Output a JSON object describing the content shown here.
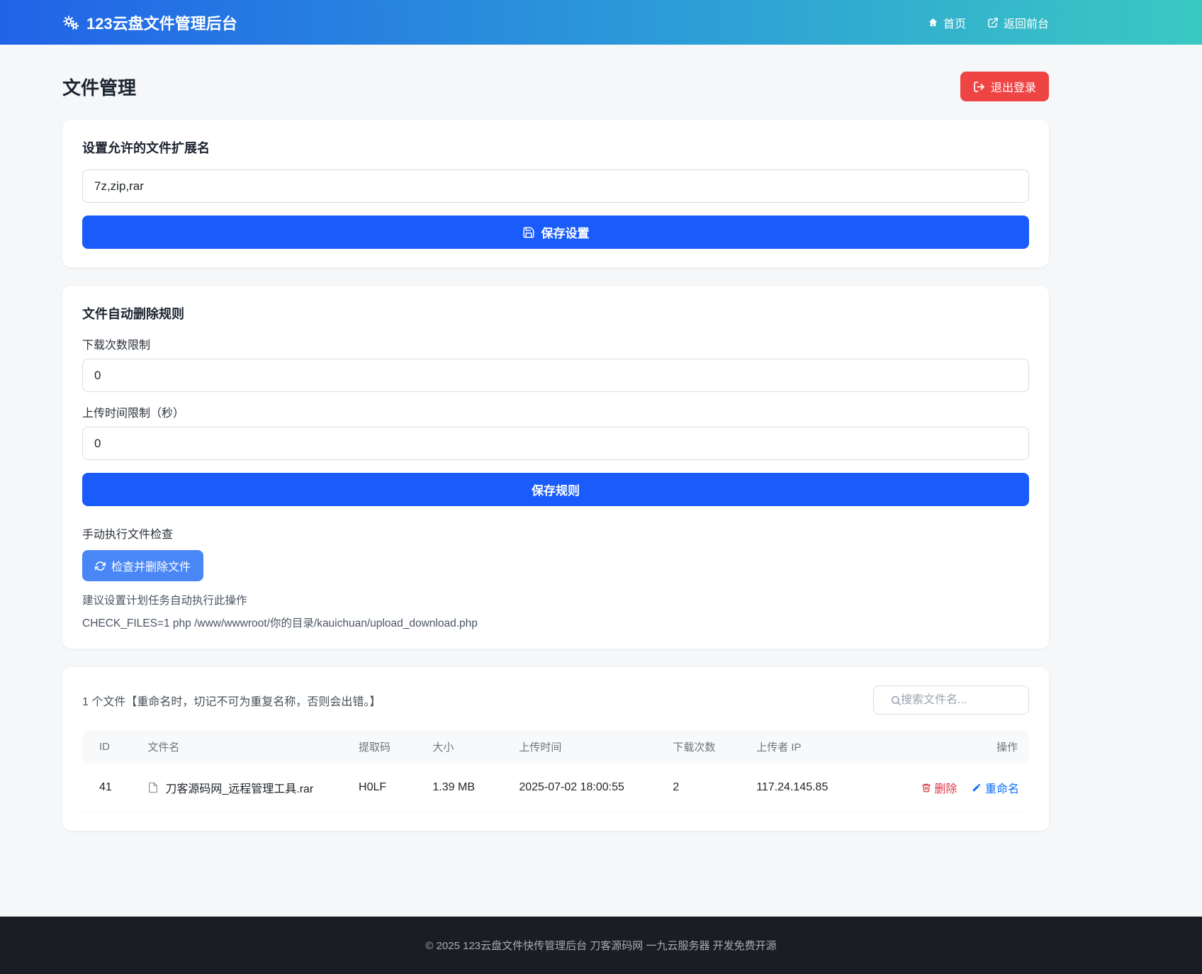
{
  "navbar": {
    "title": "123云盘文件管理后台",
    "links": [
      {
        "label": "首页"
      },
      {
        "label": "返回前台"
      }
    ]
  },
  "header": {
    "title": "文件管理",
    "logout_label": "退出登录"
  },
  "extension_card": {
    "heading": "设置允许的文件扩展名",
    "input_value": "7z,zip,rar",
    "save_label": "保存设置"
  },
  "rules_card": {
    "heading": "文件自动删除规则",
    "download_limit_label": "下载次数限制",
    "download_limit_value": "0",
    "upload_time_label": "上传时间限制（秒）",
    "upload_time_value": "0",
    "save_label": "保存规则",
    "manual_check_label": "手动执行文件检查",
    "check_button_label": "检查并删除文件",
    "tip1": "建议设置计划任务自动执行此操作",
    "tip2": "CHECK_FILES=1 php /www/wwwroot/你的目录/kauichuan/upload_download.php"
  },
  "files_card": {
    "summary": "1 个文件【重命名时，切记不可为重复名称，否则会出错。】",
    "search_placeholder": "搜索文件名...",
    "table": {
      "headers": [
        "ID",
        "文件名",
        "提取码",
        "大小",
        "上传时间",
        "下载次数",
        "上传者 IP",
        "操作"
      ],
      "rows": [
        {
          "id": "41",
          "name": "刀客源码网_远程管理工具.rar",
          "code": "H0LF",
          "size": "1.39 MB",
          "uploaded": "2025-07-02 18:00:55",
          "downloads": "2",
          "ip": "117.24.145.85",
          "delete_label": "删除",
          "rename_label": "重命名"
        }
      ]
    }
  },
  "footer": {
    "copyright": "© 2025 123云盘文件快传管理后台 刀客源码网 一九云服务器 开发免费开源"
  },
  "icons": {
    "brand": "gears-icon",
    "home": "home-icon",
    "frontend": "external-link-icon",
    "logout": "sign-out-icon",
    "save": "floppy-icon",
    "check": "refresh-icon",
    "search": "search-icon",
    "file": "file-icon",
    "delete": "trash-icon",
    "rename": "pencil-icon"
  },
  "colors": {
    "navbar_gradient_start": "#2163e8",
    "navbar_gradient_end": "#3ac9c2",
    "primary_button": "#1a5cfb",
    "check_button": "#4a87f6",
    "logout_button": "#ef4444",
    "delete_link": "#dc3545",
    "rename_link": "#0d6efd",
    "footer_bg": "#1a1d23",
    "page_bg": "#f5f7f9"
  }
}
